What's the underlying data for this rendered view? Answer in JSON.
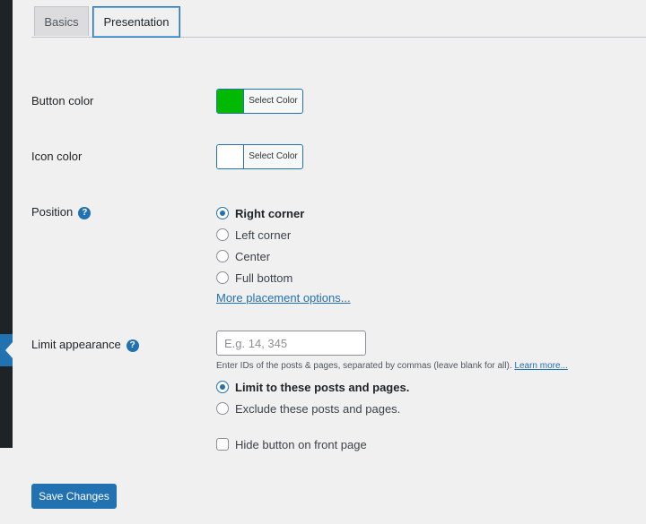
{
  "tabs": [
    {
      "label": "Basics",
      "active": false
    },
    {
      "label": "Presentation",
      "active": true
    }
  ],
  "fields": {
    "button_color": {
      "label": "Button color",
      "button_text": "Select Color",
      "value": "#00b900"
    },
    "icon_color": {
      "label": "Icon color",
      "button_text": "Select Color",
      "value": "#ffffff"
    },
    "position": {
      "label": "Position",
      "options": [
        "Right corner",
        "Left corner",
        "Center",
        "Full bottom"
      ],
      "selected": "Right corner",
      "more_link": "More placement options..."
    },
    "limit_appearance": {
      "label": "Limit appearance",
      "placeholder": "E.g. 14, 345",
      "value": "",
      "description": "Enter IDs of the posts & pages, separated by commas (leave blank for all).",
      "learn_more": "Learn more...",
      "mode_options": [
        "Limit to these posts and pages.",
        "Exclude these posts and pages."
      ],
      "mode_selected": "Limit to these posts and pages."
    },
    "hide_front_page": {
      "label": "Hide button on front page",
      "checked": false
    }
  },
  "actions": {
    "save_label": "Save Changes"
  },
  "colors": {
    "accent": "#2271b1",
    "background": "#f0f0f1",
    "sidebar": "#1d2327"
  }
}
